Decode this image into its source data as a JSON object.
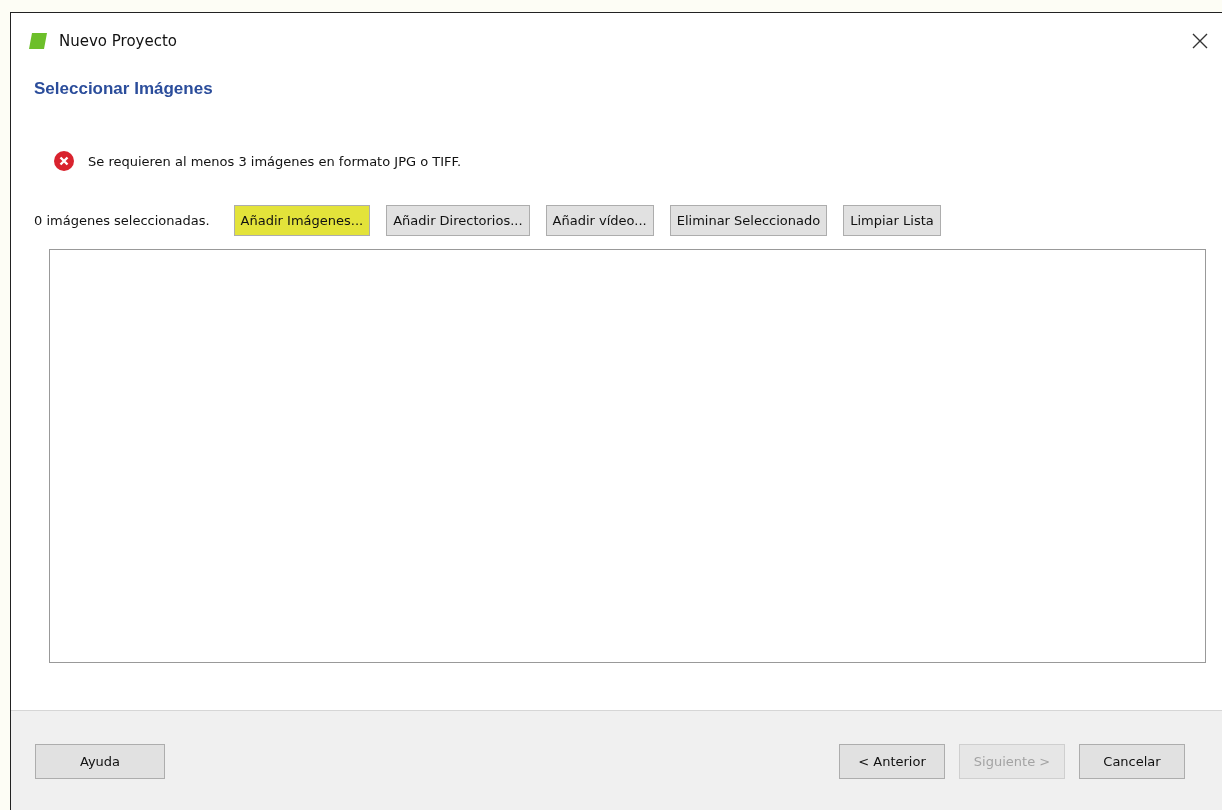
{
  "window": {
    "title": "Nuevo Proyecto"
  },
  "heading": "Seleccionar Imágenes",
  "error": {
    "message": "Se requieren al menos 3 imágenes en formato JPG o TIFF."
  },
  "count_label": "0 imágenes seleccionadas.",
  "toolbar_buttons": [
    {
      "label": "Añadir Imágenes...",
      "highlighted": true
    },
    {
      "label": "Añadir Directorios...",
      "highlighted": false
    },
    {
      "label": "Añadir vídeo...",
      "highlighted": false
    },
    {
      "label": "Eliminar Seleccionado",
      "highlighted": false
    },
    {
      "label": "Limpiar Lista",
      "highlighted": false
    }
  ],
  "help_button": {
    "label": "Ayuda"
  },
  "nav_buttons": [
    {
      "label": "< Anterior",
      "disabled": false
    },
    {
      "label": "Siguiente >",
      "disabled": true
    },
    {
      "label": "Cancelar",
      "disabled": false
    }
  ]
}
